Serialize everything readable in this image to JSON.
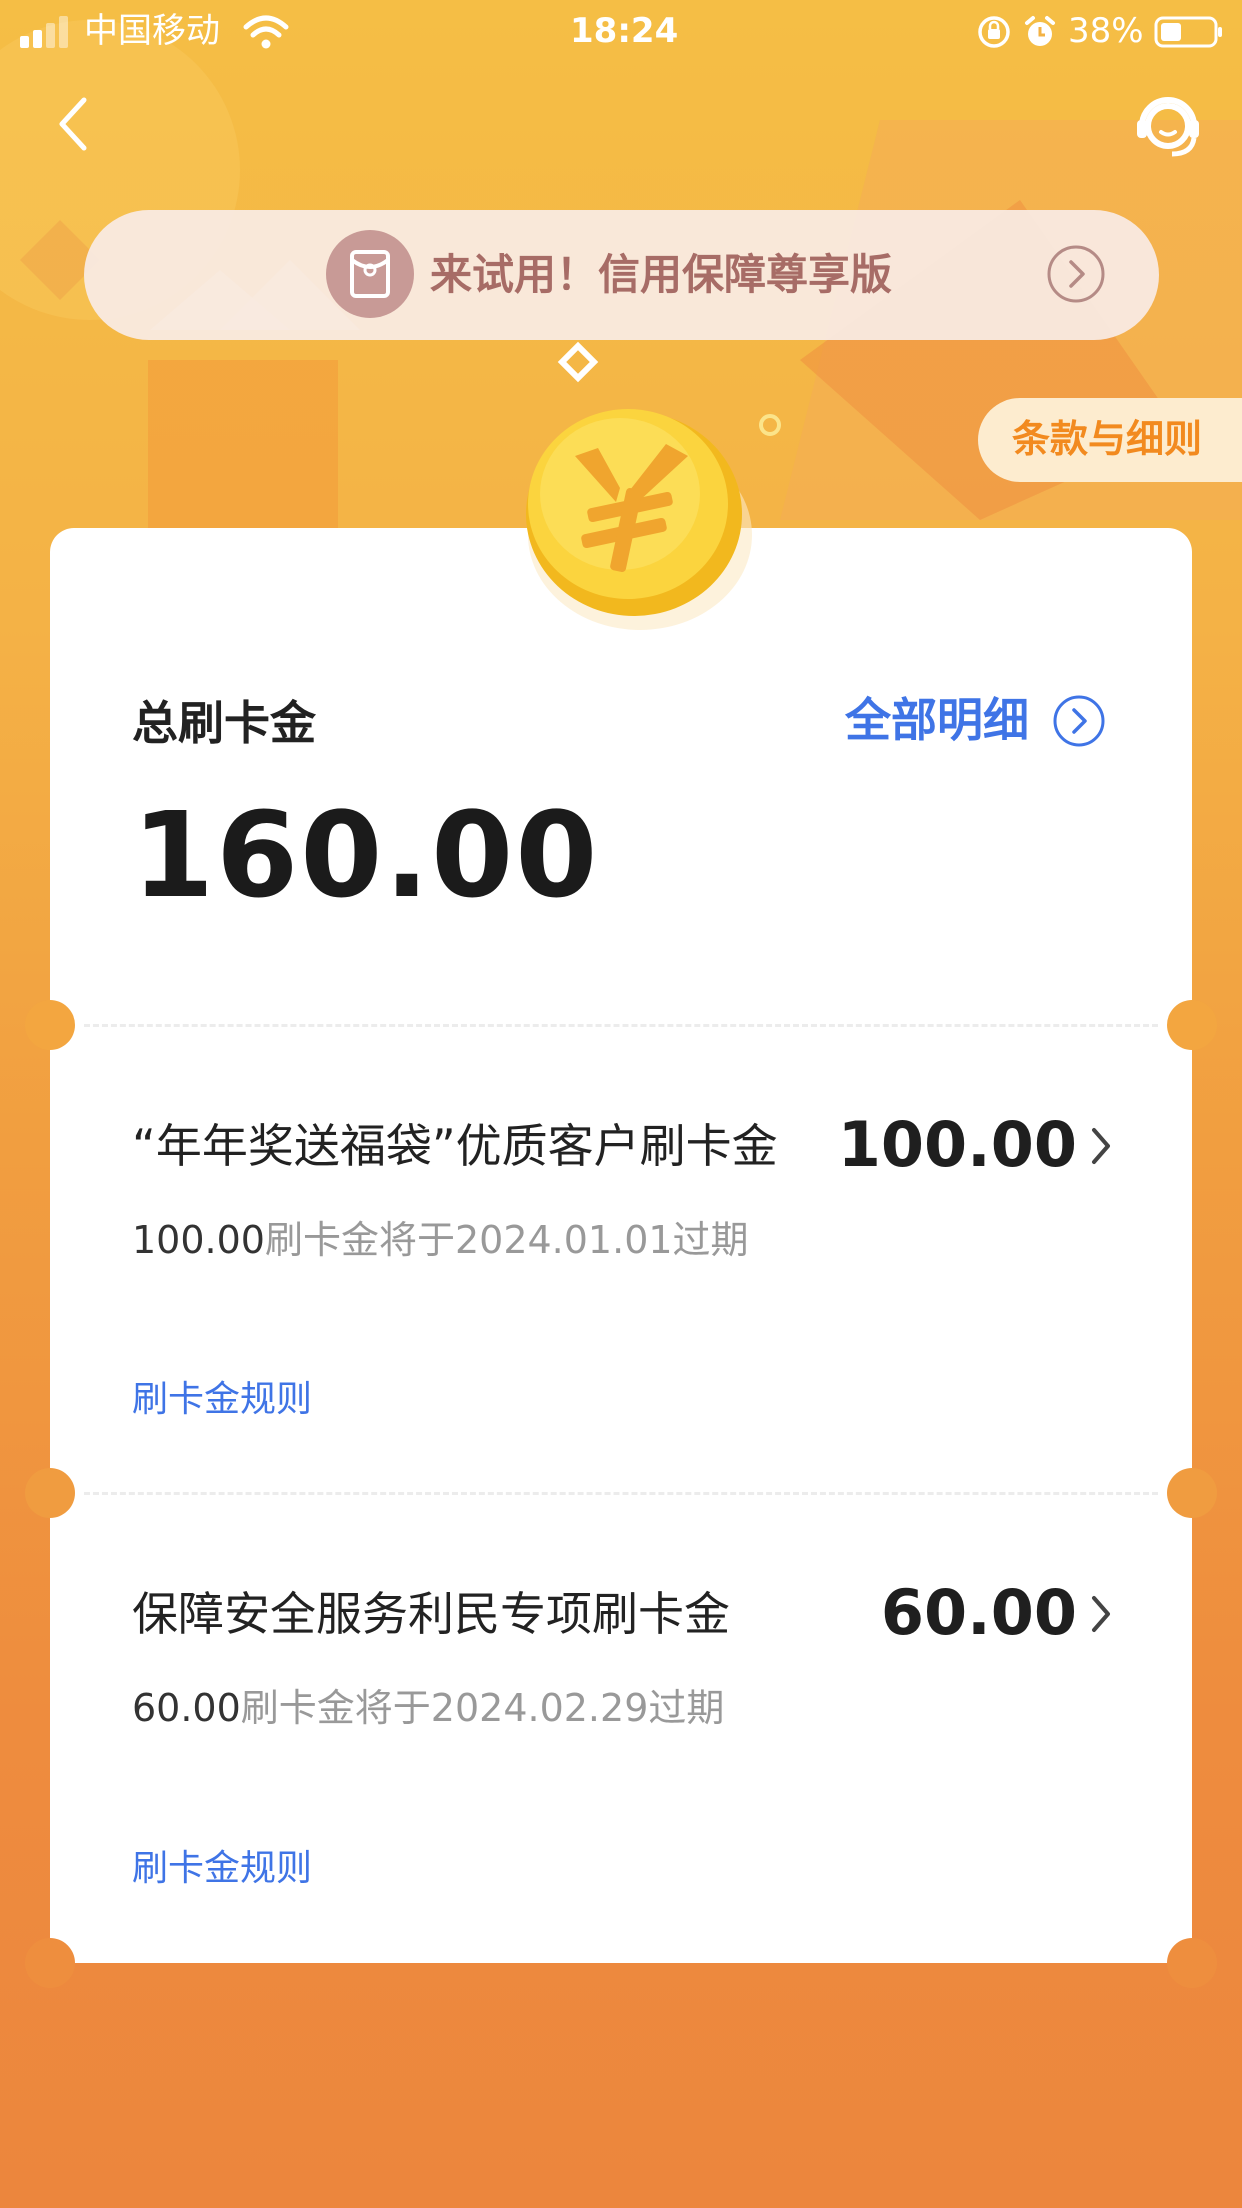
{
  "status_bar": {
    "carrier": "中国移动",
    "time": "18:24",
    "battery": "38%",
    "icons": [
      "signal-icon",
      "wifi-icon",
      "orientation-lock-icon",
      "alarm-icon",
      "battery-icon"
    ]
  },
  "header": {
    "back_icon": "chevron-left-icon",
    "service_icon": "customer-service-headset-icon"
  },
  "banner": {
    "text": "来试用！信用保障尊享版",
    "icon": "red-envelope-icon",
    "arrow_icon": "circle-chevron-right-icon"
  },
  "terms_button": "条款与细则",
  "summary": {
    "title": "总刷卡金",
    "detail_link": "全部明细",
    "total": "160.00"
  },
  "items": [
    {
      "title": "“年年奖送福袋”优质客户刷卡金",
      "amount": "100.00",
      "expire_amount": "100.00",
      "expire_text": "刷卡金将于2024.01.01过期",
      "rule_link": "刷卡金规则"
    },
    {
      "title": "保障安全服务利民专项刷卡金",
      "amount": "60.00",
      "expire_amount": "60.00",
      "expire_text": "刷卡金将于2024.02.29过期",
      "rule_link": "刷卡金规则"
    }
  ],
  "colors": {
    "background_top": "#f5be45",
    "background_bottom": "#ec863d",
    "link_blue": "#3f74e6",
    "terms_orange": "#f28a1f",
    "banner_text": "#a76c66"
  }
}
